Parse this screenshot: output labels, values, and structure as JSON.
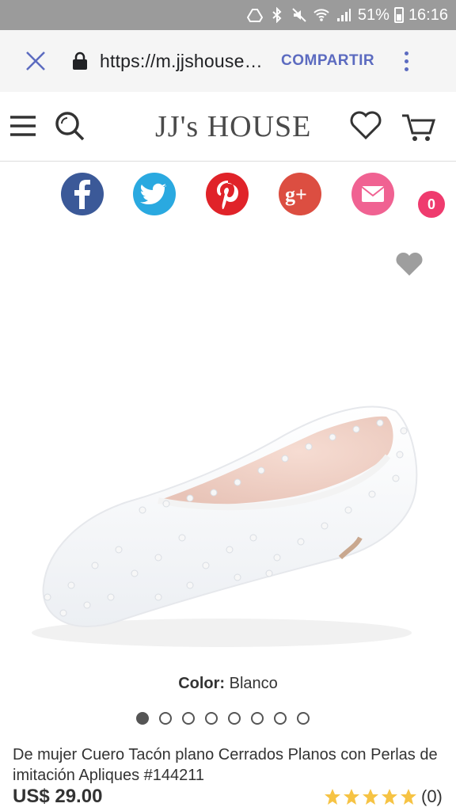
{
  "status_bar": {
    "battery": "51%",
    "time": "16:16"
  },
  "browser": {
    "url": "https://m.jjshouse…",
    "share_label": "COMPARTIR"
  },
  "site": {
    "logo": "JJ's HOUSE",
    "cart_count": "0"
  },
  "social": [
    "facebook-icon",
    "twitter-icon",
    "pinterest-icon",
    "google-plus-icon",
    "email-icon"
  ],
  "product": {
    "color_label": "Color:",
    "color_value": "Blanco",
    "image_count": 8,
    "active_image": 1,
    "title": "De mujer Cuero Tacón plano Cerrados Planos con Perlas de imitación Apliques #144211",
    "price": "US$ 29.00",
    "rating_stars": 5,
    "review_count": "(0)"
  },
  "colors": {
    "accent": "#5c6bc0",
    "badge": "#ef3b6e",
    "star": "#f6c344",
    "facebook": "#3b5998",
    "twitter": "#2aa9e0",
    "pinterest": "#e02329",
    "google_plus": "#dc4e41",
    "email": "#f06292"
  }
}
